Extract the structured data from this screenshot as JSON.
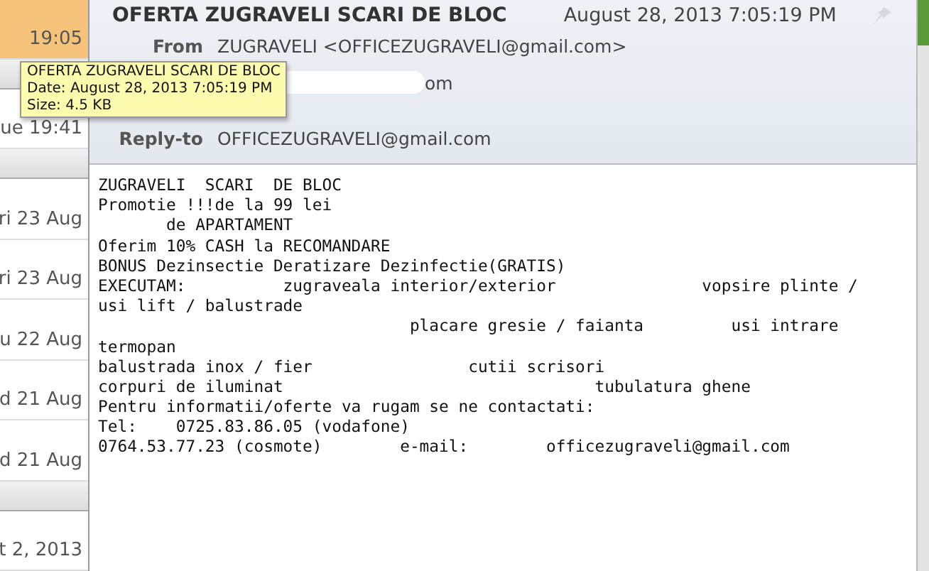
{
  "message_list": [
    {
      "kind": "message",
      "time": "19:05",
      "selected": true
    },
    {
      "kind": "group"
    },
    {
      "kind": "message",
      "time": "ue 19:41",
      "selected": false
    },
    {
      "kind": "group"
    },
    {
      "kind": "message",
      "time": "ri 23 Aug",
      "selected": false
    },
    {
      "kind": "message",
      "time": "ri 23 Aug",
      "selected": false
    },
    {
      "kind": "message",
      "time": "u 22 Aug",
      "selected": false
    },
    {
      "kind": "message",
      "time": "d 21 Aug",
      "selected": false
    },
    {
      "kind": "message",
      "time": "d 21 Aug",
      "selected": false
    },
    {
      "kind": "group"
    },
    {
      "kind": "message",
      "time": "t 2, 2013",
      "selected": false
    }
  ],
  "header": {
    "subject": "OFERTA ZUGRAVELI SCARI DE BLOC",
    "date": "August 28, 2013 7:05:19 PM",
    "fields": [
      {
        "label": "From",
        "value": "ZUGRAVELI <OFFICEZUGRAVELI@gmail.com>",
        "redacted": false
      },
      {
        "value": "om",
        "redacted": true
      },
      {
        "label": "Reply-to",
        "value": "OFFICEZUGRAVELI@gmail.com",
        "redacted": false
      }
    ]
  },
  "tooltip": [
    "OFERTA ZUGRAVELI SCARI DE BLOC",
    "Date: August 28, 2013 7:05:19 PM",
    "Size: 4.5 KB"
  ],
  "body": [
    "ZUGRAVELI  SCARI  DE BLOC",
    "Promotie !!!de la 99 lei",
    "       de APARTAMENT",
    "Oferim 10% CASH la RECOMANDARE",
    "BONUS Dezinsectie Deratizare Dezinfectie(GRATIS)",
    "EXECUTAM:          zugraveala interior/exterior               vopsire plinte /",
    "usi lift / balustrade",
    "                                placare gresie / faianta         usi intrare",
    "termopan",
    "balustrada inox / fier                cutii scrisori",
    "corpuri de iluminat                                tubulatura ghene",
    "Pentru informatii/oferte va rugam se ne contactati:",
    "Tel:    0725.83.86.05 (vodafone)",
    "0764.53.77.23 (cosmote)        e-mail:        officezugraveli@gmail.com"
  ]
}
